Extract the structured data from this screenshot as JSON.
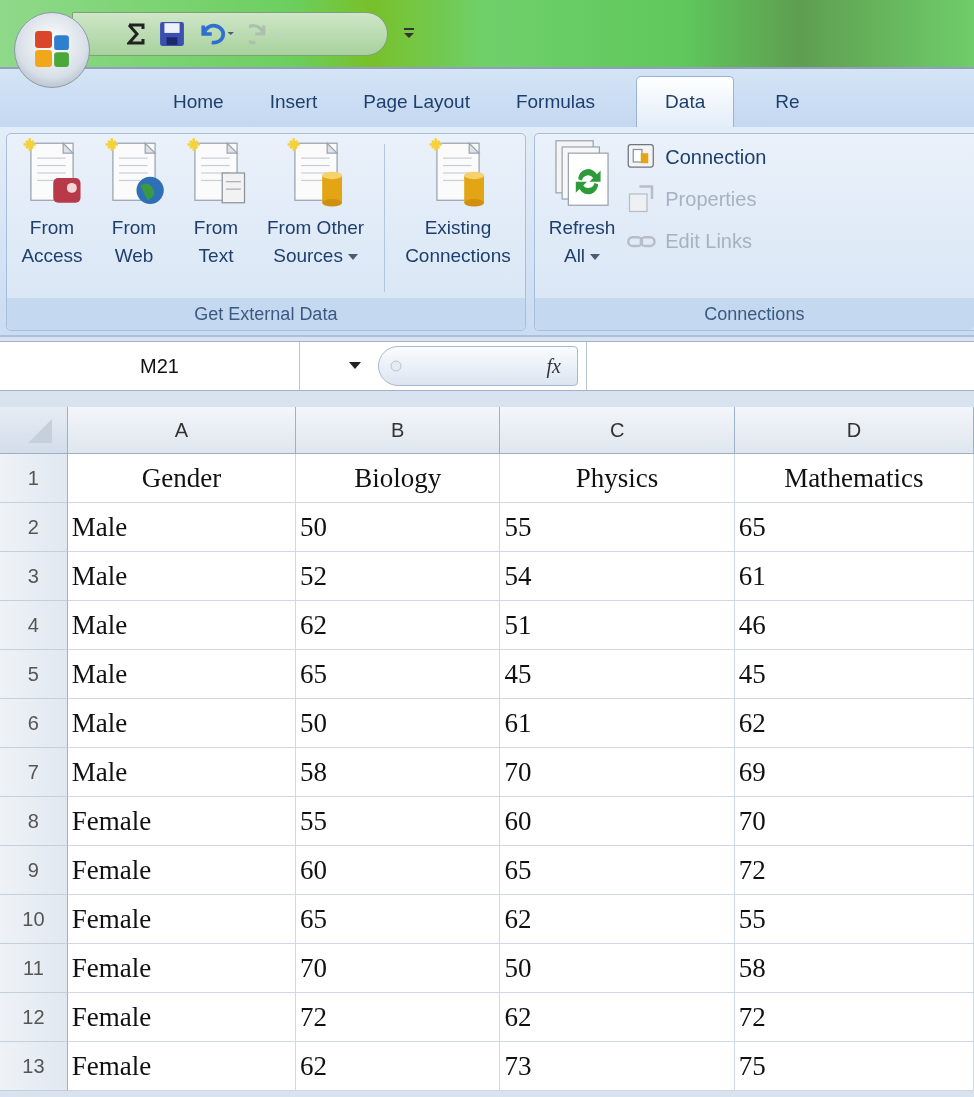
{
  "quick_access": {
    "redo_disabled": true
  },
  "tabs": [
    {
      "label": "Home",
      "selected": false
    },
    {
      "label": "Insert",
      "selected": false
    },
    {
      "label": "Page Layout",
      "selected": false
    },
    {
      "label": "Formulas",
      "selected": false
    },
    {
      "label": "Data",
      "selected": true
    },
    {
      "label": "Re",
      "selected": false
    }
  ],
  "ribbon": {
    "groups": [
      {
        "label": "Get External Data",
        "sections": [
          {
            "buttons": [
              {
                "kind": "large",
                "lines": [
                  "From",
                  "Access"
                ],
                "dropdown": false
              },
              {
                "kind": "large",
                "lines": [
                  "From",
                  "Web"
                ],
                "dropdown": false
              },
              {
                "kind": "large",
                "lines": [
                  "From",
                  "Text"
                ],
                "dropdown": false
              },
              {
                "kind": "large",
                "lines": [
                  "From Other",
                  "Sources"
                ],
                "dropdown": true
              }
            ]
          },
          {
            "buttons": [
              {
                "kind": "large",
                "lines": [
                  "Existing",
                  "Connections"
                ],
                "dropdown": false
              }
            ]
          }
        ]
      },
      {
        "label": "Connections",
        "sections": [
          {
            "buttons": [
              {
                "kind": "large",
                "lines": [
                  "Refresh",
                  "All"
                ],
                "dropdown": true
              },
              {
                "kind": "small",
                "label": "Connection",
                "disabled": false
              },
              {
                "kind": "small",
                "label": "Properties",
                "disabled": true
              },
              {
                "kind": "small",
                "label": "Edit Links",
                "disabled": true
              }
            ]
          }
        ]
      }
    ]
  },
  "formula_bar": {
    "name_box": "M21",
    "function_button": "fx"
  },
  "table": {
    "columns": [
      "A",
      "B",
      "C",
      "D"
    ],
    "header_row": {
      "number": "1",
      "cells": [
        "Gender",
        "Biology",
        "Physics",
        "Mathematics"
      ]
    },
    "rows": [
      {
        "number": "2",
        "cells": [
          "Male",
          "50",
          "55",
          "65"
        ]
      },
      {
        "number": "3",
        "cells": [
          "Male",
          "52",
          "54",
          "61"
        ]
      },
      {
        "number": "4",
        "cells": [
          "Male",
          "62",
          "51",
          "46"
        ]
      },
      {
        "number": "5",
        "cells": [
          "Male",
          "65",
          "45",
          "45"
        ]
      },
      {
        "number": "6",
        "cells": [
          "Male",
          "50",
          "61",
          "62"
        ]
      },
      {
        "number": "7",
        "cells": [
          "Male",
          "58",
          "70",
          "69"
        ]
      },
      {
        "number": "8",
        "cells": [
          "Female",
          "55",
          "60",
          "70"
        ]
      },
      {
        "number": "9",
        "cells": [
          "Female",
          "60",
          "65",
          "72"
        ]
      },
      {
        "number": "10",
        "cells": [
          "Female",
          "65",
          "62",
          "55"
        ]
      },
      {
        "number": "11",
        "cells": [
          "Female",
          "70",
          "50",
          "58"
        ]
      },
      {
        "number": "12",
        "cells": [
          "Female",
          "72",
          "62",
          "72"
        ]
      },
      {
        "number": "13",
        "cells": [
          "Female",
          "62",
          "73",
          "75"
        ]
      }
    ]
  }
}
